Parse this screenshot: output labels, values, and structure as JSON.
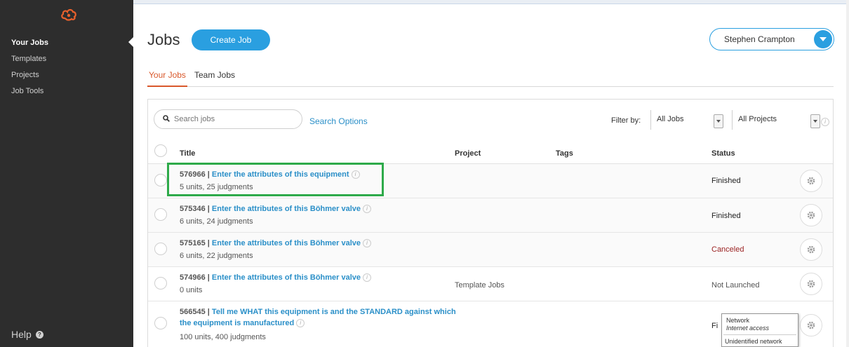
{
  "sidebar": {
    "items": [
      {
        "label": "Your Jobs"
      },
      {
        "label": "Templates"
      },
      {
        "label": "Projects"
      },
      {
        "label": "Job Tools"
      }
    ],
    "help_label": "Help"
  },
  "header": {
    "title": "Jobs",
    "create_label": "Create Job",
    "user_name": "Stephen Crampton"
  },
  "tabs": [
    {
      "label": "Your Jobs",
      "active": true
    },
    {
      "label": "Team Jobs",
      "active": false
    }
  ],
  "search": {
    "placeholder": "Search jobs",
    "options_label": "Search Options"
  },
  "filters": {
    "label": "Filter by:",
    "jobs_value": "All Jobs",
    "projects_value": "All Projects"
  },
  "table": {
    "columns": [
      "Title",
      "Project",
      "Tags",
      "Status"
    ],
    "rows": [
      {
        "id": "576966",
        "title": "Enter the attributes of this equipment",
        "units": "5 units, 25 judgments",
        "project": "",
        "status": "Finished"
      },
      {
        "id": "575346",
        "title": "Enter the attributes of this Böhmer valve",
        "units": "6 units, 24 judgments",
        "project": "",
        "status": "Finished"
      },
      {
        "id": "575165",
        "title": "Enter the attributes of this Böhmer valve",
        "units": "6 units, 22 judgments",
        "project": "",
        "status": "Canceled"
      },
      {
        "id": "574966",
        "title": "Enter the attributes of this Böhmer valve",
        "units": "0 units",
        "project": "Template Jobs",
        "status": "Not Launched"
      },
      {
        "id": "566545",
        "title": "Tell me WHAT this equipment is and the STANDARD against which the equipment is manufactured",
        "units": "100 units, 400 judgments",
        "project": "",
        "status": "Fi"
      }
    ]
  },
  "tooltip": {
    "line1": "Network",
    "line2": "Internet access",
    "line3": "Unidentified network"
  },
  "colors": {
    "accent": "#2a9fe0",
    "link": "#2a8fc8",
    "tab_active": "#d9582b",
    "canceled": "#9b2323",
    "highlight": "#2eaa4a",
    "sidebar": "#2d2d2d"
  }
}
